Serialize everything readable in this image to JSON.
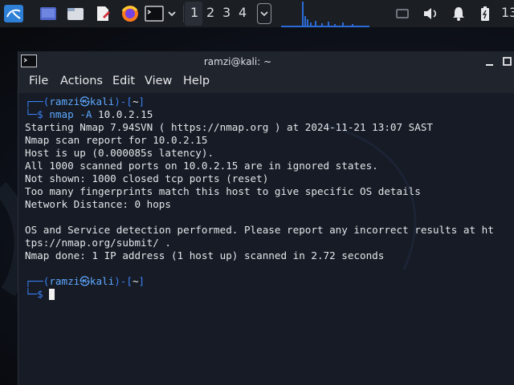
{
  "panel": {
    "workspaces": [
      "1",
      "2",
      "3",
      "4"
    ],
    "clock": "13",
    "icons": [
      "kali-menu-icon",
      "show-desktop-icon",
      "file-manager-icon",
      "text-editor-icon",
      "firefox-icon",
      "terminal-icon",
      "chevron-down-icon",
      "workspace-menu-chevron-icon",
      "cpu-graph-icon",
      "display-icon",
      "volume-icon",
      "notification-bell-icon",
      "battery-icon"
    ]
  },
  "window": {
    "title": "ramzi@kali: ~",
    "menus": [
      "File",
      "Actions",
      "Edit",
      "View",
      "Help"
    ]
  },
  "terminal": {
    "prompt1": {
      "corner": "┌──(",
      "user": "ramzi",
      "at": "㉿",
      "host": "kali",
      "mid": ")-[",
      "dir": "~",
      "end": "]",
      "arrow": "└─$",
      "cmd": "nmap",
      "args": " -A ",
      "target": "10.0.2.15"
    },
    "output": [
      "Starting Nmap 7.94SVN ( https://nmap.org ) at 2024-11-21 13:07 SAST",
      "Nmap scan report for 10.0.2.15",
      "Host is up (0.000085s latency).",
      "All 1000 scanned ports on 10.0.2.15 are in ignored states.",
      "Not shown: 1000 closed tcp ports (reset)",
      "Too many fingerprints match this host to give specific OS details",
      "Network Distance: 0 hops",
      "",
      "OS and Service detection performed. Please report any incorrect results at ht",
      "tps://nmap.org/submit/ .",
      "Nmap done: 1 IP address (1 host up) scanned in 2.72 seconds"
    ],
    "prompt2": {
      "corner": "┌──(",
      "user": "ramzi",
      "at": "㉿",
      "host": "kali",
      "mid": ")-[",
      "dir": "~",
      "end": "]",
      "arrow": "└─$"
    }
  }
}
